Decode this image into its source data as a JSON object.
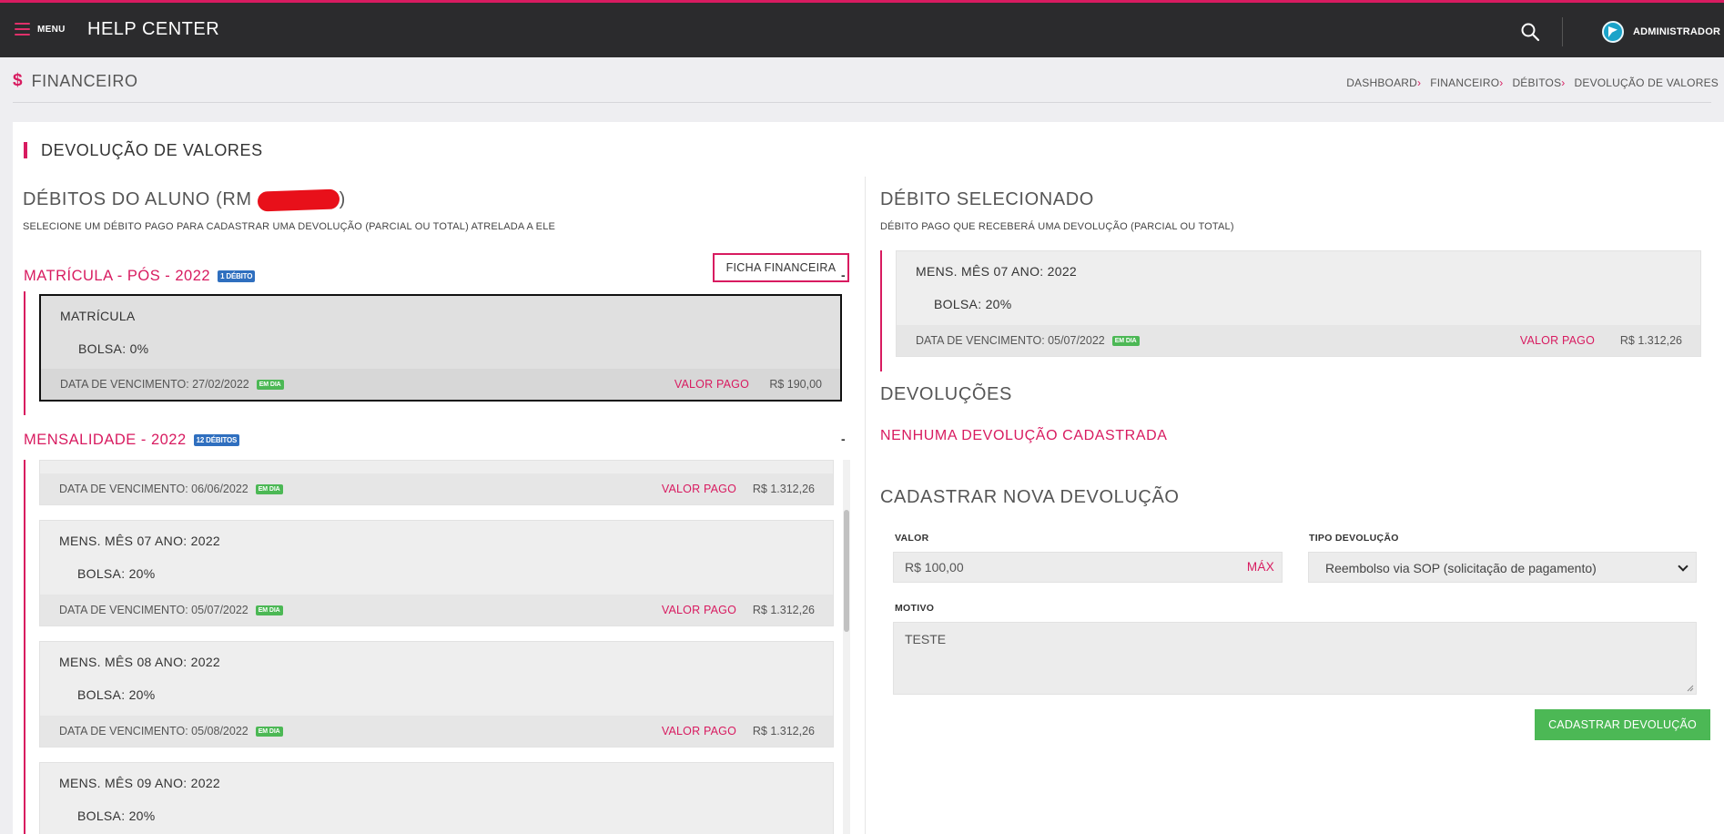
{
  "topbar": {
    "menu_label": "MENU",
    "app_title": "HELP CENTER",
    "user_name": "ADMINISTRADOR"
  },
  "page": {
    "title": "FINANCEIRO",
    "breadcrumb": [
      "DASHBOARD",
      "FINANCEIRO",
      "DÉBITOS",
      "DEVOLUÇÃO DE VALORES"
    ]
  },
  "card": {
    "title": "DEVOLUÇÃO DE VALORES"
  },
  "left": {
    "title": "DÉBITOS DO ALUNO (RM",
    "title_tail": ")",
    "subtitle": "SELECIONE UM DÉBITO PAGO PARA CADASTRAR UMA DEVOLUÇÃO (PARCIAL OU TOTAL) ATRELADA A ELE",
    "ficha_button": "FICHA FINANCEIRA",
    "groups": [
      {
        "title": "MATRÍCULA - PÓS - 2022",
        "badge": "1 DÉBITO",
        "collapse": "-",
        "debits": [
          {
            "name": "MATRÍCULA",
            "bolsa": "BOLSA: 0%",
            "due": "DATA DE VENCIMENTO: 27/02/2022",
            "status": "EM DIA",
            "paid_label": "VALOR PAGO",
            "paid_value": "R$ 190,00"
          }
        ]
      },
      {
        "title": "MENSALIDADE - 2022",
        "badge": "12 DÉBITOS",
        "collapse": "-",
        "debits": [
          {
            "due": "DATA DE VENCIMENTO: 06/06/2022",
            "status": "EM DIA",
            "paid_label": "VALOR PAGO",
            "paid_value": "R$ 1.312,26"
          },
          {
            "name": "MENS. MÊS 07 ANO: 2022",
            "bolsa": "BOLSA: 20%",
            "due": "DATA DE VENCIMENTO: 05/07/2022",
            "status": "EM DIA",
            "paid_label": "VALOR PAGO",
            "paid_value": "R$ 1.312,26"
          },
          {
            "name": "MENS. MÊS 08 ANO: 2022",
            "bolsa": "BOLSA: 20%",
            "due": "DATA DE VENCIMENTO: 05/08/2022",
            "status": "EM DIA",
            "paid_label": "VALOR PAGO",
            "paid_value": "R$ 1.312,26"
          },
          {
            "name": "MENS. MÊS 09 ANO: 2022",
            "bolsa": "BOLSA: 20%"
          }
        ]
      }
    ]
  },
  "right": {
    "selected_title": "DÉBITO SELECIONADO",
    "selected_subtitle": "DÉBITO PAGO QUE RECEBERÁ UMA DEVOLUÇÃO (PARCIAL OU TOTAL)",
    "selected_debit": {
      "name": "MENS. MÊS 07 ANO: 2022",
      "bolsa": "BOLSA: 20%",
      "due": "DATA DE VENCIMENTO: 05/07/2022",
      "status": "EM DIA",
      "paid_label": "VALOR PAGO",
      "paid_value": "R$ 1.312,26"
    },
    "devolucoes_title": "DEVOLUÇÕES",
    "devolucoes_empty": "NENHUMA DEVOLUÇÃO CADASTRADA",
    "form_title": "CADASTRAR NOVA DEVOLUÇÃO",
    "valor_label": "VALOR",
    "valor_value": "R$ 100,00",
    "max_label": "MÁX",
    "tipo_label": "TIPO DEVOLUÇÃO",
    "tipo_value": "Reembolso via SOP (solicitação de pagamento)",
    "motivo_label": "MOTIVO",
    "motivo_value": "TESTE",
    "submit_label": "CADASTRAR DEVOLUÇÃO"
  },
  "colors": {
    "accent": "#d81b60",
    "topbar": "#2b2b2d",
    "success": "#4cb855",
    "badge_blue": "#2f6fbf"
  }
}
